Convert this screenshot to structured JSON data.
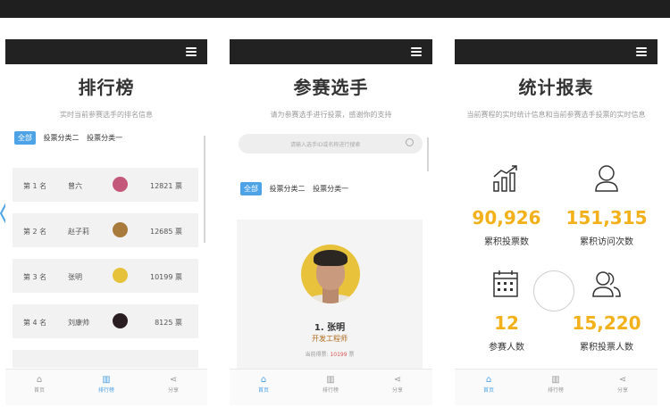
{
  "colors": {
    "accent": "#4da3e6",
    "vote_red": "#d9534f",
    "stat_gold": "#f2b11b",
    "bar": "#222222"
  },
  "ranking": {
    "title": "排行榜",
    "subtitle": "实时当前参赛选手的排名信息",
    "tabs": [
      "全部",
      "投票分类二",
      "投票分类一"
    ],
    "rows": [
      {
        "pos": "第 1 名",
        "name": "曾六",
        "votes": "12821 票"
      },
      {
        "pos": "第 2 名",
        "name": "赵子莉",
        "votes": "12685 票"
      },
      {
        "pos": "第 3 名",
        "name": "张明",
        "votes": "10199 票"
      },
      {
        "pos": "第 4 名",
        "name": "刘康帅",
        "votes": "8125 票"
      }
    ],
    "tabbar": [
      {
        "label": "首页",
        "icon": "home-icon"
      },
      {
        "label": "排行榜",
        "icon": "bar-chart-icon"
      },
      {
        "label": "分享",
        "icon": "share-icon"
      }
    ]
  },
  "contestants": {
    "title": "参赛选手",
    "subtitle": "请为参赛选手进行投票，感谢你的支持",
    "search_placeholder": "请输入选手ID或名称进行搜索",
    "tabs": [
      "全部",
      "投票分类二",
      "投票分类一"
    ],
    "card": {
      "name": "1. 张明",
      "role": "开发工程师",
      "votes_prefix": "当前得票:",
      "votes_value": "10199",
      "votes_suffix": "票"
    },
    "tabbar": [
      {
        "label": "首页",
        "icon": "home-icon"
      },
      {
        "label": "排行榜",
        "icon": "bar-chart-icon"
      },
      {
        "label": "分享",
        "icon": "share-icon"
      }
    ]
  },
  "stats": {
    "title": "统计报表",
    "subtitle": "当前赛程的实时统计信息和当前参赛选手投票的实时信息",
    "items": [
      {
        "value": "90,926",
        "label": "累积投票数",
        "icon": "growth-chart-icon"
      },
      {
        "value": "151,315",
        "label": "累积访问次数",
        "icon": "user-icon"
      },
      {
        "value": "12",
        "label": "参赛人数",
        "icon": "calendar-icon"
      },
      {
        "value": "15,220",
        "label": "累积投票人数",
        "icon": "users-icon"
      }
    ],
    "tabbar": [
      {
        "label": "首页",
        "icon": "home-icon"
      },
      {
        "label": "排行榜",
        "icon": "bar-chart-icon"
      },
      {
        "label": "分享",
        "icon": "share-icon"
      }
    ]
  }
}
